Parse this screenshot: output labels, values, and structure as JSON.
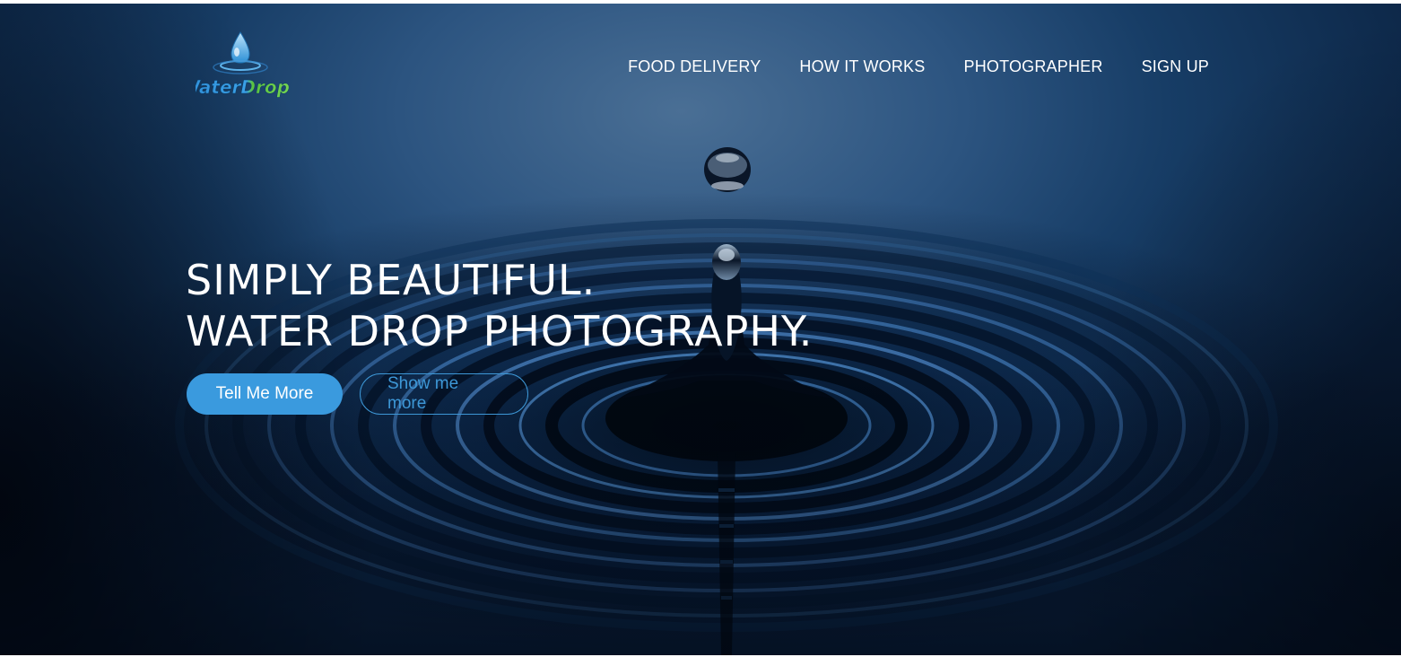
{
  "brand": {
    "logo_text": "WaterDrops",
    "logo_icon": "water-drop-icon"
  },
  "nav": {
    "items": [
      {
        "label": "FOOD DELIVERY"
      },
      {
        "label": "HOW IT WORKS"
      },
      {
        "label": "PHOTOGRAPHER"
      },
      {
        "label": "SIGN UP"
      }
    ]
  },
  "hero": {
    "headline_line1": "SIMPLY BEAUTIFUL.",
    "headline_line2": "WATER DROP PHOTOGRAPHY.",
    "primary_button": "Tell Me More",
    "secondary_button": "Show me more"
  },
  "colors": {
    "accent": "#3a9ade",
    "outline": "#3d97d6",
    "nav_text": "#ffffff",
    "hero_bg": "#173d66"
  }
}
